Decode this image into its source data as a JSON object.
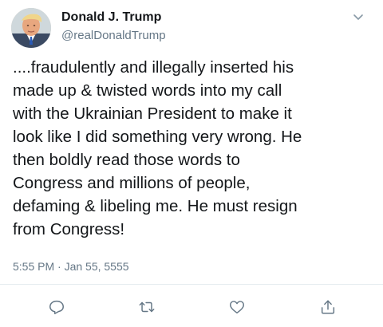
{
  "tweet": {
    "author": {
      "display_name": "Donald J. Trump",
      "handle": "@realDonaldTrump"
    },
    "text": "....fraudulently and illegally inserted his\nmade up & twisted words into my call\nwith the Ukrainian President to make it\nlook like I did something very wrong. He\nthen boldly read those words to\nCongress and millions of people,\ndefaming & libeling me. He must resign\nfrom Congress!",
    "timestamp": "5:55 PM · Jan 55, 5555"
  },
  "icons": {
    "menu": "chevron-down-icon",
    "reply": "reply-icon",
    "retweet": "retweet-icon",
    "like": "heart-icon",
    "share": "share-icon"
  },
  "colors": {
    "text_primary": "#14171a",
    "text_secondary": "#657786",
    "icon": "#657786",
    "divider": "#e6ecf0"
  }
}
